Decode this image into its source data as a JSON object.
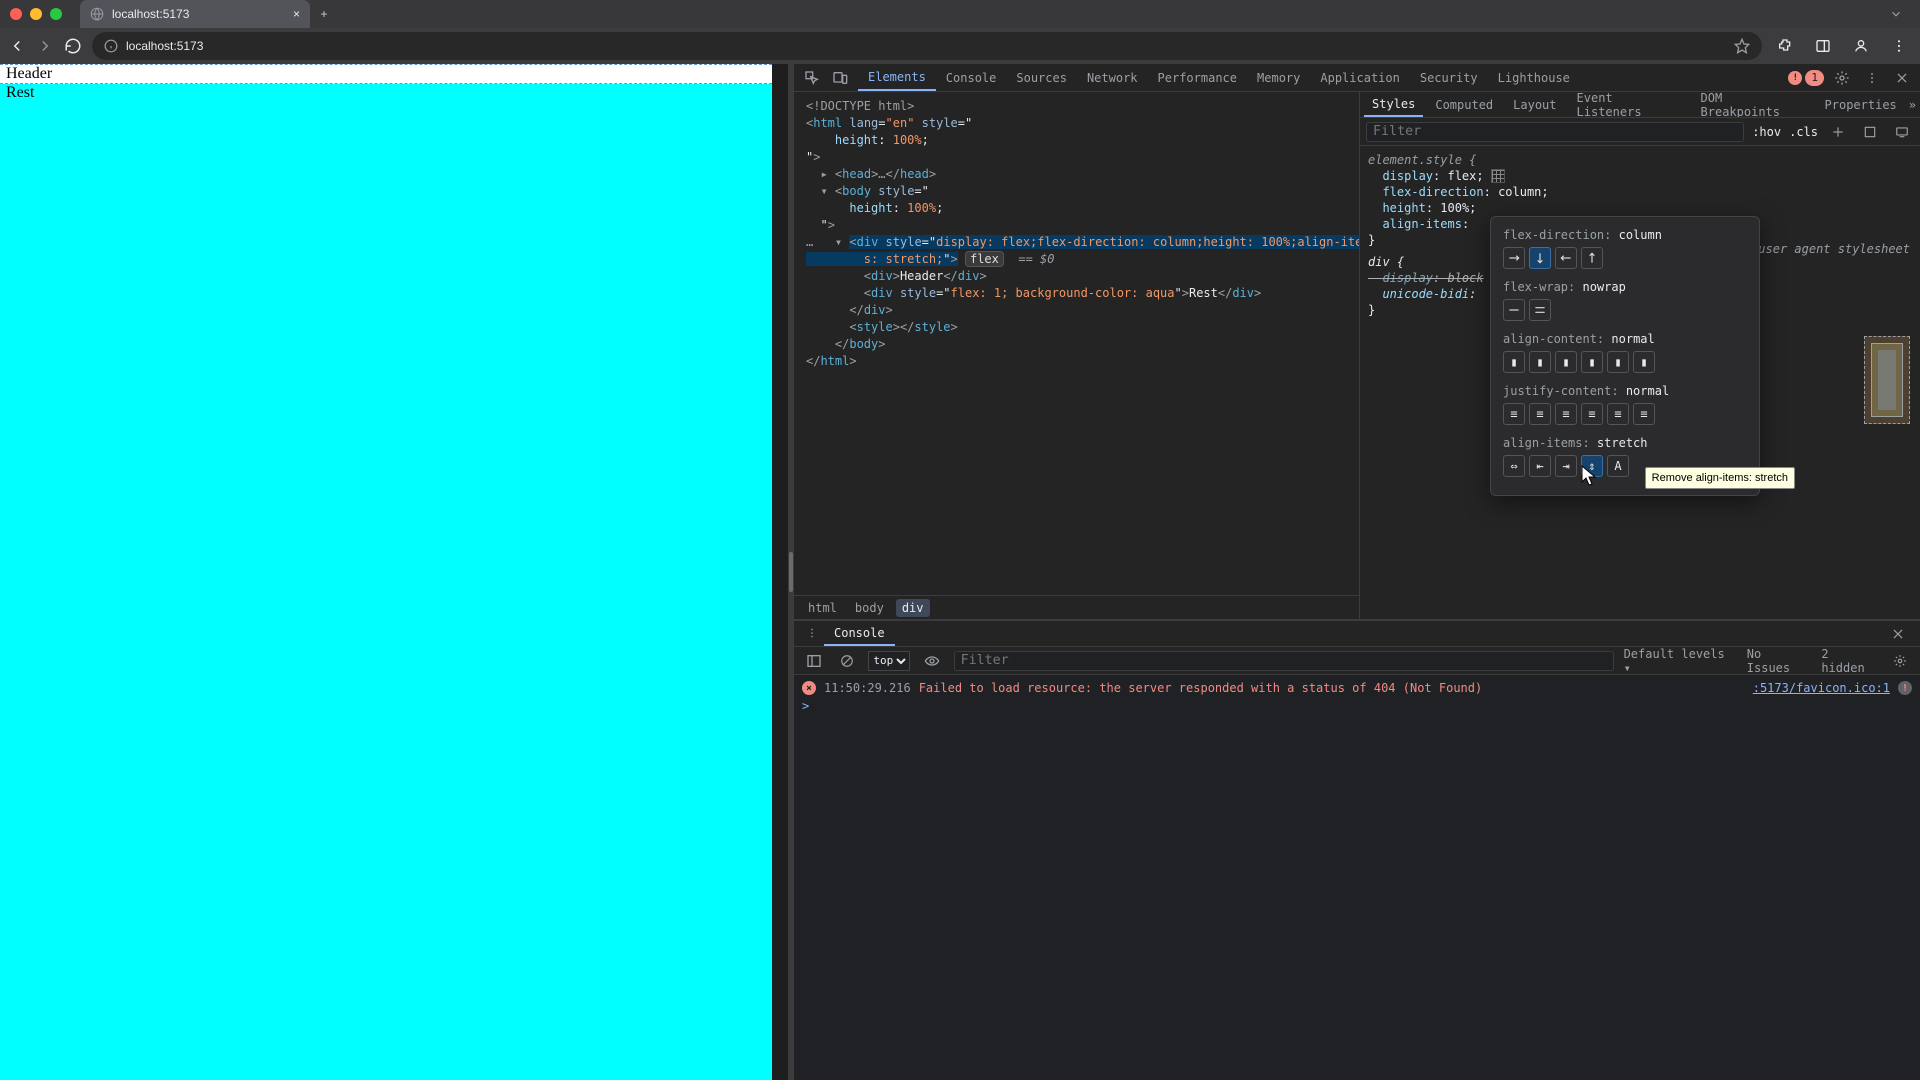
{
  "window": {
    "tab_title": "localhost:5173",
    "close_glyph": "×",
    "add_glyph": "+"
  },
  "traffic": {
    "close": "#ff5f57",
    "min": "#febc2e",
    "max": "#28c840"
  },
  "nav": {
    "url_scheme_muted": "",
    "url": "localhost:5173"
  },
  "page": {
    "header_text": "Header",
    "rest_text": "Rest"
  },
  "devtools": {
    "tabs": [
      "Elements",
      "Console",
      "Sources",
      "Network",
      "Performance",
      "Memory",
      "Application",
      "Security",
      "Lighthouse"
    ],
    "active_tab": "Elements",
    "error_count": "1"
  },
  "dom": {
    "doctype": "<!DOCTYPE html>",
    "html_open": "<html lang=\"en\" style=\"",
    "html_style_decl1_p": "height",
    "html_style_decl1_v": "100%",
    "html_open_end": "\">",
    "head": "<head>…</head>",
    "body_open": "<body style=\"",
    "body_style_decl1_p": "height",
    "body_style_decl1_v": "100%",
    "body_open_end": "\">",
    "div_open_a": "<div style=\"",
    "div_style": "display: flex;flex-direction: column;height: 100%;align-item",
    "div_style_cont": "s: stretch;",
    "div_open_b": "\">",
    "flex_pill": "flex",
    "eq_dollar": "== $0",
    "child1": "<div>Header</div>",
    "child2_open": "<div style=\"",
    "child2_style": "flex: 1; background-color: aqua",
    "child2_open_end": "\">Rest</div>",
    "div_close": "</div>",
    "style_tag": "<style></style>",
    "body_close": "</body>",
    "html_close": "</html>"
  },
  "crumbs": [
    "html",
    "body",
    "div"
  ],
  "styles": {
    "tabs": [
      "Styles",
      "Computed",
      "Layout",
      "Event Listeners",
      "DOM Breakpoints",
      "Properties"
    ],
    "filter_placeholder": "Filter",
    "hov": ":hov",
    "cls": ".cls",
    "rule1_sel": "element.style {",
    "r1_d1_p": "display",
    "r1_d1_v": "flex;",
    "r1_d2_p": "flex-direction",
    "r1_d2_v": "column;",
    "r1_d3_p": "height",
    "r1_d3_v": "100%;",
    "r1_d4_p": "align-items",
    "r1_d4_v": "",
    "rule1_close": "}",
    "rule2_sel": "div {",
    "r2_d1_p": "display",
    "r2_d1_v": "block",
    "r2_d2_p": "unicode-bidi",
    "r2_d2_v": "",
    "rule2_close": "}",
    "ua_label": "user agent stylesheet"
  },
  "popover": {
    "flex_direction_label": "flex-direction:",
    "flex_direction_value": "column",
    "flex_wrap_label": "flex-wrap:",
    "flex_wrap_value": "nowrap",
    "align_content_label": "align-content:",
    "align_content_value": "normal",
    "justify_content_label": "justify-content:",
    "justify_content_value": "normal",
    "align_items_label": "align-items:",
    "align_items_value": "stretch",
    "tooltip": "Remove align-items: stretch"
  },
  "console": {
    "tab_label": "Console",
    "top_label": "top",
    "filter_placeholder": "Filter",
    "default_levels": "Default levels",
    "no_issues": "No Issues",
    "hidden": "2 hidden",
    "log_time": "11:50:29.216",
    "log_msg": "Failed to load resource: the server responded with a status of 404 (Not Found)",
    "log_src": ":5173/favicon.ico:1",
    "prompt": ">"
  }
}
